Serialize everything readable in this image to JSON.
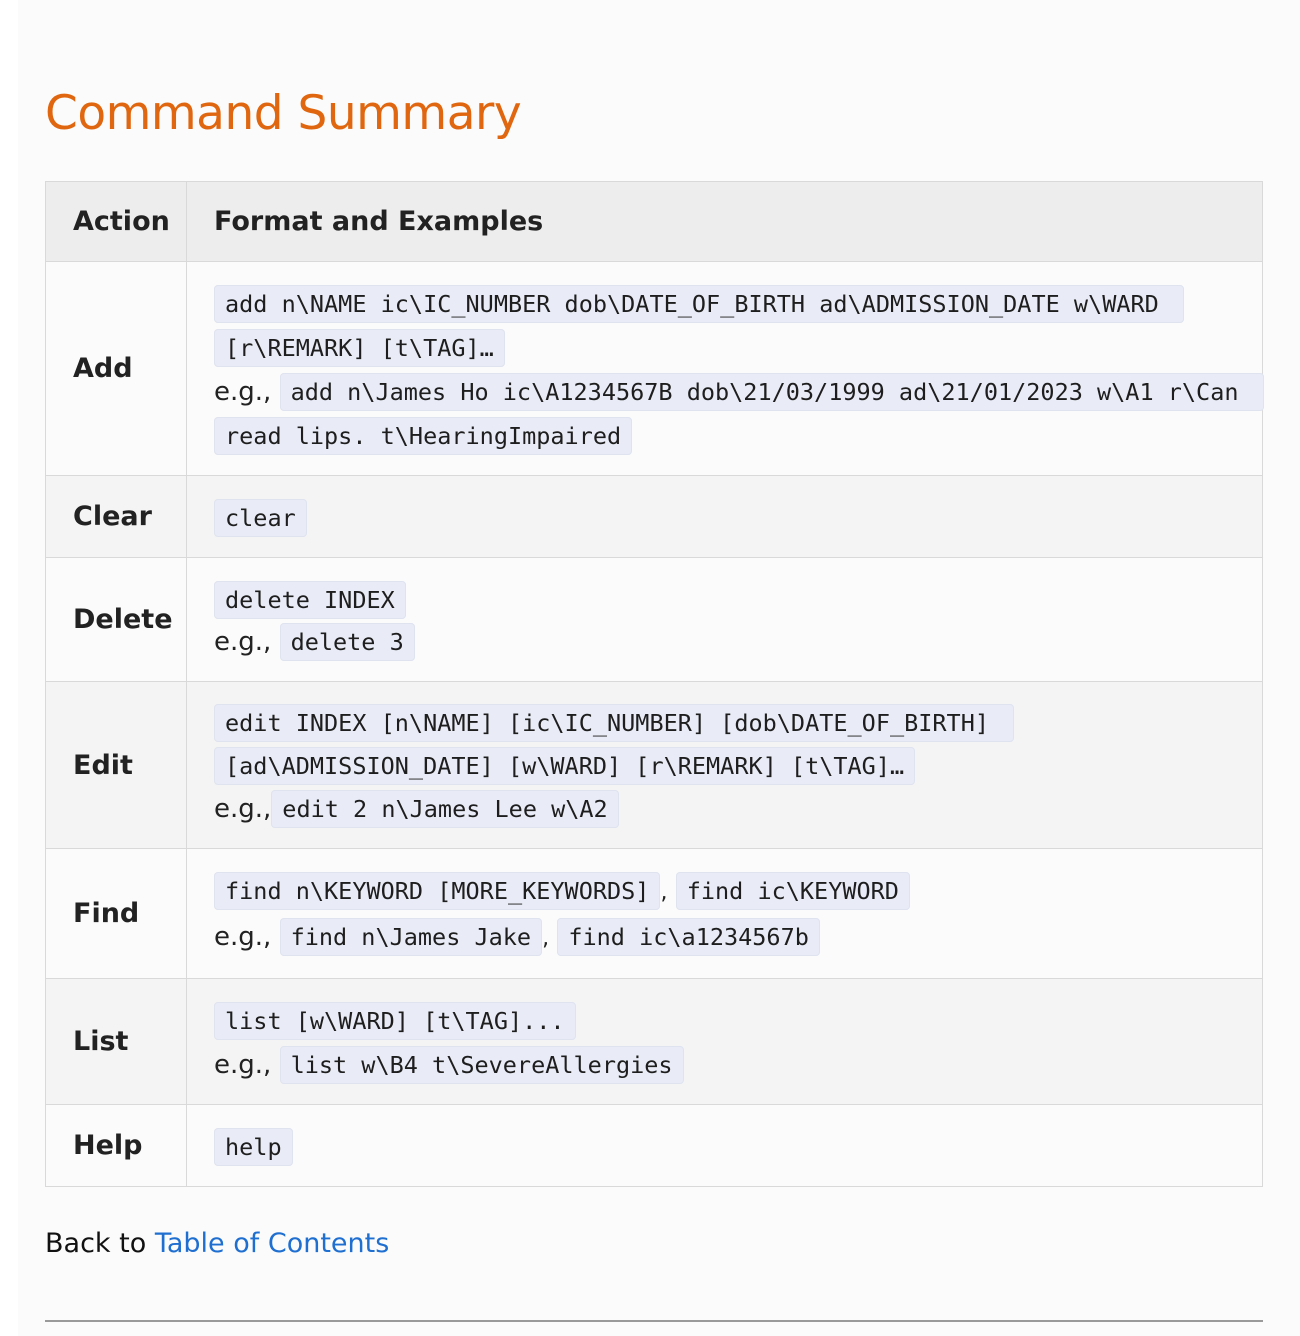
{
  "title": "Command Summary",
  "table": {
    "header_action": "Action",
    "header_format": "Format and Examples",
    "eg": "e.g.,",
    "comma": ",",
    "rows": {
      "add": {
        "action": "Add",
        "format": "add n\\NAME ic\\IC_NUMBER dob\\DATE_OF_BIRTH ad\\ADMISSION_DATE w\\WARD [r\\REMARK] [t\\TAG]…",
        "example": "add n\\James Ho ic\\A1234567B dob\\21/03/1999 ad\\21/01/2023 w\\A1 r\\Can read lips. t\\HearingImpaired"
      },
      "clear": {
        "action": "Clear",
        "format": "clear"
      },
      "delete": {
        "action": "Delete",
        "format": "delete INDEX",
        "example": "delete 3"
      },
      "edit": {
        "action": "Edit",
        "format": "edit INDEX [n\\NAME] [ic\\IC_NUMBER] [dob\\DATE_OF_BIRTH] [ad\\ADMISSION_DATE] [w\\WARD] [r\\REMARK] [t\\TAG]…",
        "example": "edit 2 n\\James Lee w\\A2"
      },
      "find": {
        "action": "Find",
        "format_1": "find n\\KEYWORD [MORE_KEYWORDS]",
        "format_2": "find ic\\KEYWORD",
        "example_1": "find n\\James Jake",
        "example_2": "find ic\\a1234567b"
      },
      "list": {
        "action": "List",
        "format": "list [w\\WARD] [t\\TAG]...",
        "example": "list w\\B4 t\\SevereAllergies"
      },
      "help": {
        "action": "Help",
        "format": "help"
      }
    }
  },
  "back": {
    "prefix": "Back to ",
    "link": "Table of Contents"
  }
}
